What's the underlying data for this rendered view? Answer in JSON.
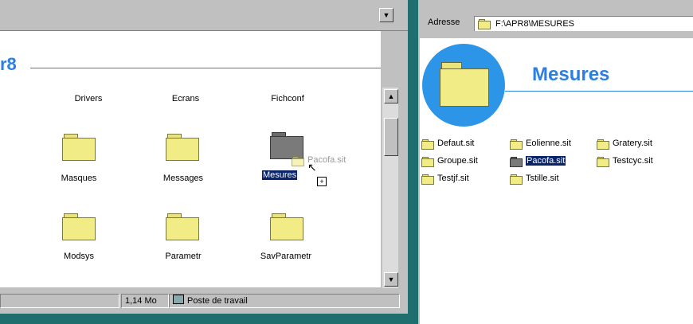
{
  "left": {
    "title_fragment": "r8",
    "columns": [
      "Drivers",
      "Ecrans",
      "Fichconf"
    ],
    "row1": [
      "Masques",
      "Messages",
      "Mesures"
    ],
    "row2": [
      "Modsys",
      "Parametr",
      "SavParametr"
    ],
    "drag_label": "Pacofa.sit",
    "plus": "+",
    "status": {
      "size": "1,14 Mo",
      "location": "Poste de travail"
    }
  },
  "right": {
    "address_label": "Adresse",
    "address_value": "F:\\APR8\\MESURES",
    "title": "Mesures",
    "files": [
      [
        "Defaut.sit",
        "Eolienne.sit",
        "Gratery.sit"
      ],
      [
        "Groupe.sit",
        "Pacofa.sit",
        "Testcyc.sit"
      ],
      [
        "Testjf.sit",
        "Tstille.sit"
      ]
    ]
  },
  "colors": {
    "accent": "#2b7fe0",
    "selection": "#0a246a",
    "desktop": "#1f6f6f"
  },
  "icons": {
    "folder": "folder-icon",
    "computer": "computer-icon"
  }
}
